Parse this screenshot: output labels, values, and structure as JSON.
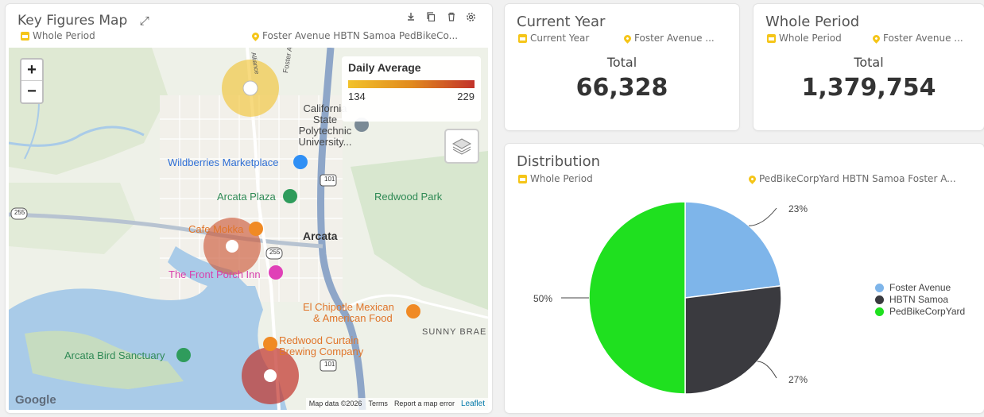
{
  "map_card": {
    "title": "Key Figures Map",
    "period": "Whole Period",
    "locations": "Foster Avenue HBTN Samoa PedBikeCo...",
    "tools": [
      "download-icon",
      "copy-icon",
      "trash-icon",
      "gear-icon"
    ],
    "zoom_in": "+",
    "zoom_out": "−",
    "legend": {
      "title": "Daily Average",
      "min": "134",
      "max": "229",
      "colors": [
        "#f2c22a",
        "#e18a1e",
        "#c2322a"
      ]
    },
    "labels": {
      "foster": "Foster Ave",
      "cal_poly": "California State Polytechnic University...",
      "wildberries": "Wildberries Marketplace",
      "arcata_plaza": "Arcata Plaza",
      "redwood_park": "Redwood Park",
      "cafe_mokka": "Cafe Mokka",
      "arcata": "Arcata",
      "front_porch": "The Front Porch Inn",
      "el_chipotle_1": "El Chipotle Mexican",
      "el_chipotle_2": "& American Food",
      "sunny_brae": "SUNNY BRAE",
      "redwood_curtain_1": "Redwood Curtain",
      "redwood_curtain_2": "Brewing Company",
      "bird_sanctuary": "Arcata Bird Sanctuary",
      "hwy101": "101",
      "hwy255": "255",
      "alliance": "Alliance"
    },
    "attribution": {
      "google": "Google",
      "map_data": "Map data ©2026",
      "terms": "Terms",
      "report": "Report a map error",
      "leaflet": "Leaflet"
    }
  },
  "current_year": {
    "title": "Current Year",
    "period": "Current Year",
    "location": "Foster Avenue ...",
    "total_label": "Total",
    "total_value": "66,328"
  },
  "whole_period": {
    "title": "Whole Period",
    "period": "Whole Period",
    "location": "Foster Avenue ...",
    "total_label": "Total",
    "total_value": "1,379,754"
  },
  "distribution": {
    "title": "Distribution",
    "period": "Whole Period",
    "locations": "PedBikeCorpYard HBTN Samoa Foster A...",
    "chart_data": {
      "type": "pie",
      "categories": [
        "Foster Avenue",
        "HBTN Samoa",
        "PedBikeCorpYard"
      ],
      "values": [
        23,
        27,
        50
      ],
      "labels": [
        "23%",
        "27%",
        "50%"
      ],
      "colors": [
        "#7eb5ea",
        "#3a3a3f",
        "#1fe01f"
      ],
      "legend": "right"
    }
  }
}
